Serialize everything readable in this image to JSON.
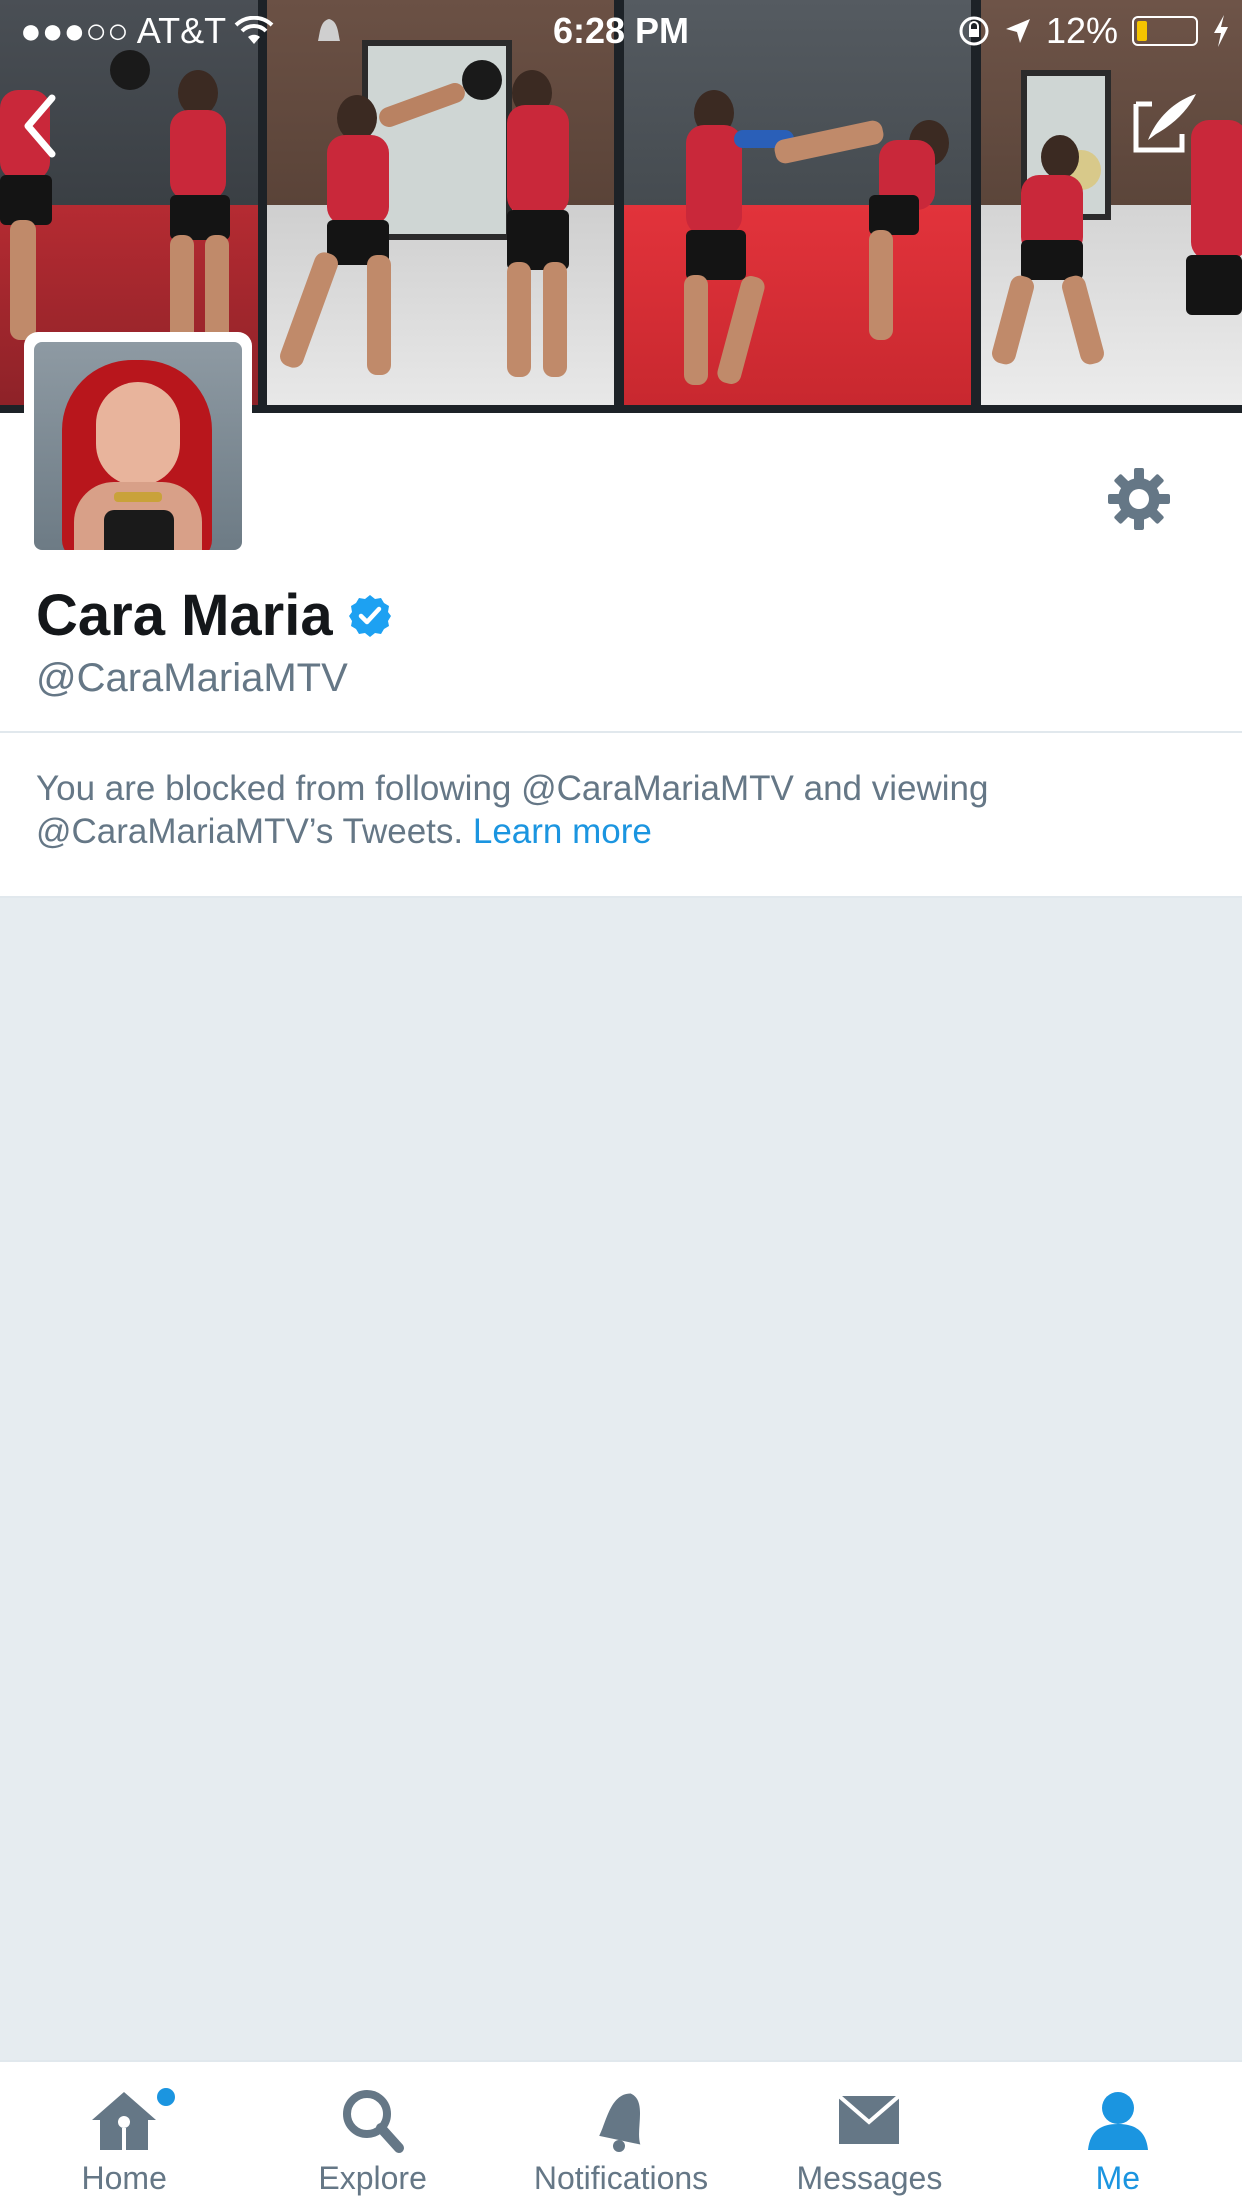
{
  "status_bar": {
    "carrier": "●●●○○ AT&T",
    "time": "6:28 PM",
    "battery": "12%"
  },
  "profile": {
    "name": "Cara Maria",
    "handle": "@CaraMariaMTV",
    "verified": true
  },
  "blocked_notice": {
    "text": "You are blocked from following @CaraMariaMTV and viewing @CaraMariaMTV’s Tweets.",
    "link": "Learn more"
  },
  "tabs": [
    {
      "label": "Home",
      "icon": "home-icon",
      "has_notification_dot": true
    },
    {
      "label": "Explore",
      "icon": "search-icon"
    },
    {
      "label": "Notifications",
      "icon": "bell-icon"
    },
    {
      "label": "Messages",
      "icon": "envelope-icon"
    },
    {
      "label": "Me",
      "icon": "person-icon",
      "active": true
    }
  ],
  "colors": {
    "accent": "#1b95e0",
    "muted": "#657786",
    "background": "#e6ecf0"
  }
}
